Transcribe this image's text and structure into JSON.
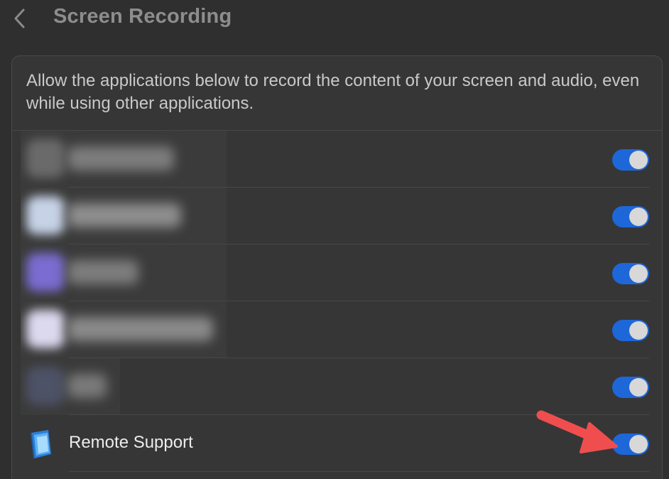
{
  "header": {
    "back_icon": "chevron-left-icon",
    "title": "Screen Recording"
  },
  "panel": {
    "description": "Allow the applications below to record the content of your screen and audio, even while using other applications."
  },
  "apps": [
    {
      "name": "",
      "blurred": true,
      "enabled": true
    },
    {
      "name": "",
      "blurred": true,
      "enabled": true
    },
    {
      "name": "",
      "blurred": true,
      "enabled": true
    },
    {
      "name": "",
      "blurred": true,
      "enabled": true
    },
    {
      "name": "",
      "blurred": true,
      "enabled": true
    },
    {
      "name": "Remote Support",
      "blurred": false,
      "enabled": true,
      "icon": "remote-support-app-icon"
    }
  ],
  "colors": {
    "toggle_on": "#1e67d8",
    "annotation_arrow": "#f04e4e",
    "background": "#2f2f2f"
  }
}
